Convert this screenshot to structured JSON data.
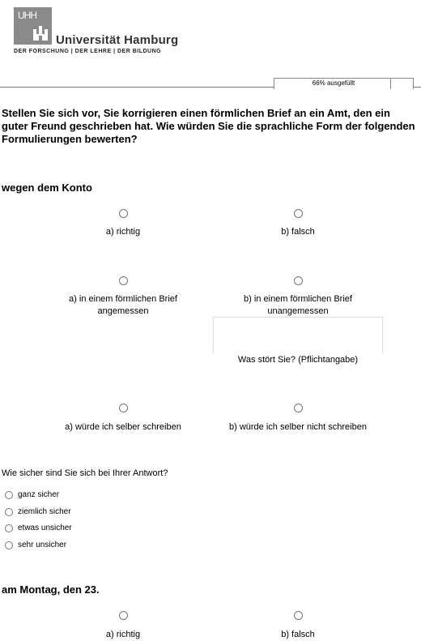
{
  "header": {
    "logo_mark": "UHH",
    "university_name": "Universität Hamburg",
    "tagline": "DER FORSCHUNG | DER LEHRE | DER BILDUNG"
  },
  "progress": {
    "label": "66% ausgefüllt",
    "percent": 66
  },
  "question": "Stellen Sie sich vor, Sie korrigieren einen förmlichen Brief an ein Amt, den ein guter Freund geschrieben hat. Wie würden Sie die sprachliche Form der folgenden Formulierungen bewerten?",
  "item1": {
    "title": "wegen dem Konto",
    "correctness": {
      "a": "a) richtig",
      "b": "b) falsch"
    },
    "appropriateness": {
      "a": "a) in einem förmlichen Brief angemessen",
      "b": "b) in einem förmlichen Brief unangemessen"
    },
    "comment_label": "Was stört Sie? (Pflichtangabe)",
    "own_usage": {
      "a": "a) würde ich selber schreiben",
      "b": "b) würde ich selber nicht schreiben"
    },
    "certainty": {
      "question": "Wie sicher sind Sie sich bei Ihrer Antwort?",
      "options": [
        "ganz sicher",
        "ziemlich sicher",
        "etwas unsicher",
        "sehr unsicher"
      ]
    }
  },
  "item2": {
    "title": "am Montag, den 23.",
    "correctness": {
      "a": "a) richtig",
      "b": "b) falsch"
    }
  }
}
